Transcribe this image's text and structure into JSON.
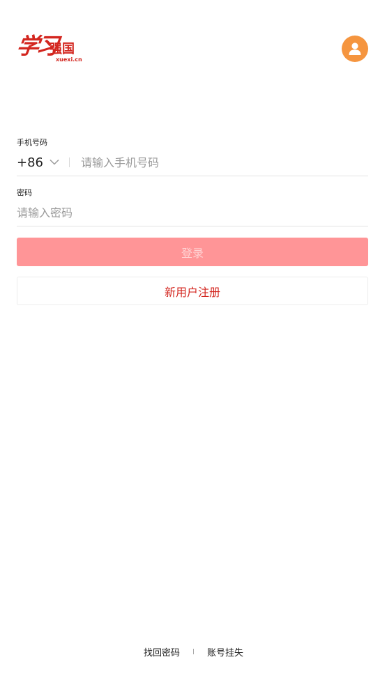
{
  "header": {
    "logo_text": "学习强国",
    "logo_calligraphy": "学习",
    "logo_block": "强国",
    "logo_domain": "xuexi.cn",
    "avatar_icon": "user-icon",
    "avatar_color": "#f5953f"
  },
  "form": {
    "phone_label": "手机号码",
    "country_code": "+86",
    "phone_placeholder": "请输入手机号码",
    "phone_value": "",
    "password_label": "密码",
    "password_placeholder": "请输入密码",
    "password_value": ""
  },
  "actions": {
    "login_label": "登录",
    "login_color": "#ff9597",
    "register_label": "新用户注册",
    "register_color": "#d3261f"
  },
  "footer": {
    "find_password": "找回密码",
    "report_lost": "账号挂失"
  }
}
